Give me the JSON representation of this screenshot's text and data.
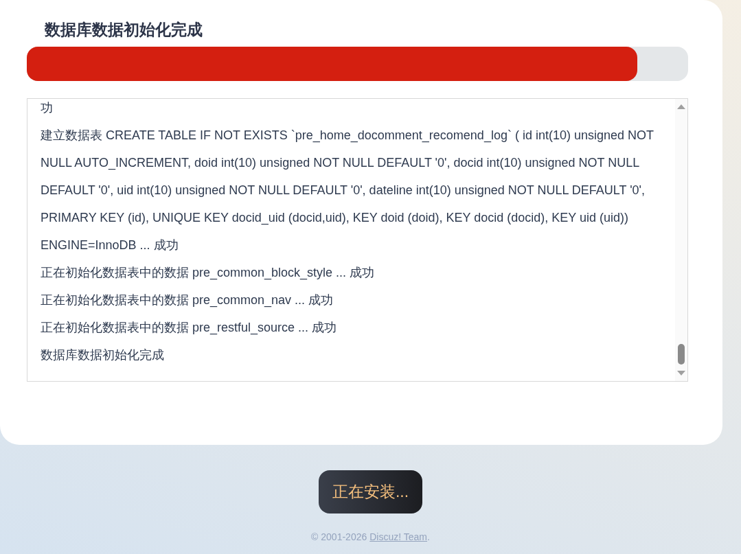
{
  "title": "数据库数据初始化完成",
  "progress": {
    "level": 0.923
  },
  "log": [
    "功",
    "建立数据表 CREATE TABLE IF NOT EXISTS `pre_home_docomment_recomend_log` ( id int(10) unsigned NOT NULL AUTO_INCREMENT, doid int(10) unsigned NOT NULL DEFAULT '0', docid int(10) unsigned NOT NULL DEFAULT '0', uid int(10) unsigned NOT NULL DEFAULT '0', dateline int(10) unsigned NOT NULL DEFAULT '0', PRIMARY KEY (id), UNIQUE KEY docid_uid (docid,uid), KEY doid (doid), KEY docid (docid), KEY uid (uid)) ENGINE=InnoDB ... 成功",
    "正在初始化数据表中的数据 pre_common_block_style ... 成功",
    "正在初始化数据表中的数据 pre_common_nav ... 成功",
    "正在初始化数据表中的数据 pre_restful_source ... 成功",
    "数据库数据初始化完成"
  ],
  "install_button": {
    "label": "正在安装...",
    "disabled": true
  },
  "footer": {
    "prefix": "© 2001-2026",
    "link": "Discuz! Team",
    "suffix": "."
  }
}
